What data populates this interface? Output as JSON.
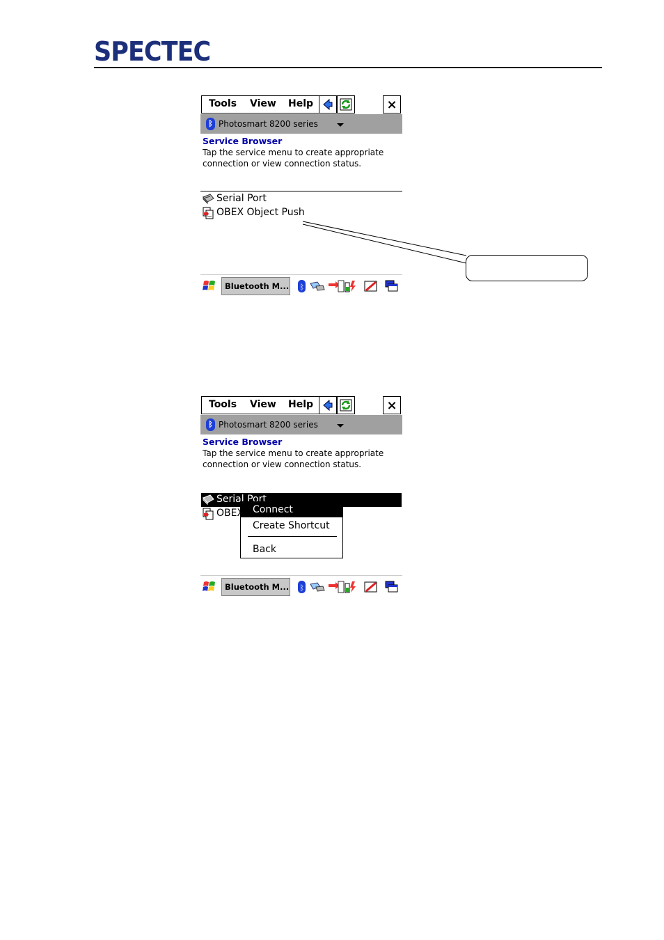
{
  "brand": {
    "logo_text": "SPECTEC"
  },
  "screens": [
    {
      "menu": {
        "tools": "Tools",
        "view": "View",
        "help": "Help",
        "close": "×"
      },
      "device": {
        "name": "Photosmart 8200 series"
      },
      "service_browser": {
        "title": "Service Browser",
        "description": "Tap the service menu to create appropriate connection or view connection status."
      },
      "services": [
        "Serial Port",
        "OBEX Object Push"
      ],
      "taskbar": {
        "button": "Bluetooth M..."
      }
    },
    {
      "menu": {
        "tools": "Tools",
        "view": "View",
        "help": "Help",
        "close": "×"
      },
      "device": {
        "name": "Photosmart 8200 series"
      },
      "service_browser": {
        "title": "Service Browser",
        "description": "Tap the service menu to create appropriate connection or view connection status."
      },
      "services": [
        "Serial Port",
        "OBEX Object Push"
      ],
      "context_menu": {
        "connect": "Connect",
        "create_shortcut": "Create Shortcut",
        "back": "Back"
      },
      "taskbar": {
        "button": "Bluetooth M..."
      }
    }
  ],
  "colors": {
    "brand_blue": "#1c2f7a",
    "title_blue": "#0000a8",
    "bluetooth_blue": "#1d3fd8",
    "device_bar_gray": "#a0a0a0"
  }
}
